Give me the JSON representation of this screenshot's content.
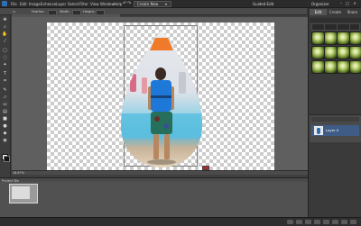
{
  "menubar": {
    "items": [
      "File",
      "Edit",
      "Image",
      "Enhance",
      "Layer",
      "Select",
      "Filter",
      "View",
      "Window",
      "Help"
    ],
    "create_new_label": "Create New",
    "top_right": [
      "Guided Edit",
      "Organizer"
    ]
  },
  "optionsbar": {
    "items": [
      "Feather:",
      "Width:",
      "Height:"
    ]
  },
  "mode_tabs": [
    "Edit",
    "Create",
    "Share"
  ],
  "status": {
    "zoom": "16.67%"
  },
  "layers": {
    "layer_name": "Layer 0"
  },
  "bin": {
    "title": "Project Bin"
  },
  "colors": {
    "accent": "#3f5c86",
    "panel": "#3a3a3a",
    "canvas_checker": "#cccccc",
    "vest_blue": "#1e78d8"
  },
  "icons": [
    "undo-icon",
    "redo-icon",
    "move-tool-icon",
    "zoom-tool-icon",
    "hand-tool-icon",
    "eyedropper-icon",
    "marquee-icon",
    "lasso-icon",
    "magic-wand-icon",
    "text-tool-icon",
    "crop-tool-icon",
    "brush-icon",
    "eraser-icon",
    "paint-bucket-icon",
    "gradient-icon",
    "shape-tool-icon"
  ]
}
